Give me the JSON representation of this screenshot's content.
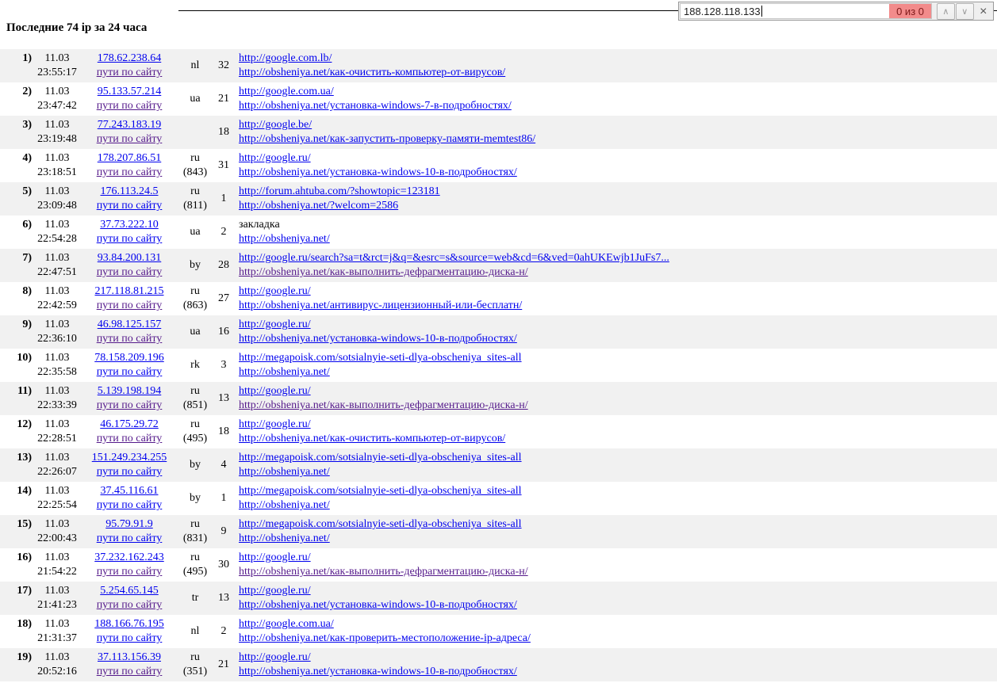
{
  "page": {
    "title": "Последние 74 ip за 24 часа"
  },
  "find_bar": {
    "query": "188.128.118.133",
    "match_count": "0 из 0",
    "prev_icon": "∧",
    "next_icon": "∨",
    "close_icon": "×"
  },
  "colors": {
    "link": "#0000EE",
    "visited": "#551A8B",
    "row_alt": "#f1f1f1",
    "badge_bg": "#f28b8b",
    "badge_text": "#7e1a1a"
  },
  "table": {
    "paths_label": "пути по сайту",
    "rows": [
      {
        "n": "1)",
        "date": "11.03",
        "time": "23:55:17",
        "ip": "178.62.238.64",
        "paths_visited": true,
        "geo": "nl",
        "geo_extra": "",
        "count": "32",
        "line1": "http://google.com.lb/",
        "line1_link": true,
        "line2": "http://obsheniya.net/как-очистить-компьютер-от-вирусов/",
        "line2_visited": false
      },
      {
        "n": "2)",
        "date": "11.03",
        "time": "23:47:42",
        "ip": "95.133.57.214",
        "paths_visited": true,
        "geo": "ua",
        "geo_extra": "",
        "count": "21",
        "line1": "http://google.com.ua/",
        "line1_link": true,
        "line2": "http://obsheniya.net/установка-windows-7-в-подробностях/",
        "line2_visited": false
      },
      {
        "n": "3)",
        "date": "11.03",
        "time": "23:19:48",
        "ip": "77.243.183.19",
        "paths_visited": true,
        "geo": "",
        "geo_extra": "",
        "count": "18",
        "line1": "http://google.be/",
        "line1_link": true,
        "line2": "http://obsheniya.net/как-запустить-проверку-памяти-memtest86/",
        "line2_visited": false
      },
      {
        "n": "4)",
        "date": "11.03",
        "time": "23:18:51",
        "ip": "178.207.86.51",
        "paths_visited": true,
        "geo": "ru",
        "geo_extra": "(843)",
        "count": "31",
        "line1": "http://google.ru/",
        "line1_link": true,
        "line2": "http://obsheniya.net/установка-windows-10-в-подробностях/",
        "line2_visited": false
      },
      {
        "n": "5)",
        "date": "11.03",
        "time": "23:09:48",
        "ip": "176.113.24.5",
        "paths_visited": false,
        "geo": "ru",
        "geo_extra": "(811)",
        "count": "1",
        "line1": "http://forum.ahtuba.com/?showtopic=123181",
        "line1_link": true,
        "line2": "http://obsheniya.net/?welcom=2586",
        "line2_visited": false
      },
      {
        "n": "6)",
        "date": "11.03",
        "time": "22:54:28",
        "ip": "37.73.222.10",
        "paths_visited": false,
        "geo": "ua",
        "geo_extra": "",
        "count": "2",
        "line1": "закладка",
        "line1_link": false,
        "line2": "http://obsheniya.net/",
        "line2_visited": false
      },
      {
        "n": "7)",
        "date": "11.03",
        "time": "22:47:51",
        "ip": "93.84.200.131",
        "paths_visited": true,
        "geo": "by",
        "geo_extra": "",
        "count": "28",
        "line1": "http://google.ru/search?sa=t&rct=j&q=&esrc=s&source=web&cd=6&ved=0ahUKEwjb1JuFs7...",
        "line1_link": true,
        "line2": "http://obsheniya.net/как-выполнить-дефрагментацию-диска-н/",
        "line2_visited": true
      },
      {
        "n": "8)",
        "date": "11.03",
        "time": "22:42:59",
        "ip": "217.118.81.215",
        "paths_visited": true,
        "geo": "ru",
        "geo_extra": "(863)",
        "count": "27",
        "line1": "http://google.ru/",
        "line1_link": true,
        "line2": "http://obsheniya.net/антивирус-лицензионный-или-бесплатн/",
        "line2_visited": false
      },
      {
        "n": "9)",
        "date": "11.03",
        "time": "22:36:10",
        "ip": "46.98.125.157",
        "paths_visited": true,
        "geo": "ua",
        "geo_extra": "",
        "count": "16",
        "line1": "http://google.ru/",
        "line1_link": true,
        "line2": "http://obsheniya.net/установка-windows-10-в-подробностях/",
        "line2_visited": false
      },
      {
        "n": "10)",
        "date": "11.03",
        "time": "22:35:58",
        "ip": "78.158.209.196",
        "paths_visited": false,
        "geo": "rk",
        "geo_extra": "",
        "count": "3",
        "line1": "http://megapoisk.com/sotsialnyie-seti-dlya-obscheniya_sites-all",
        "line1_link": true,
        "line2": "http://obsheniya.net/",
        "line2_visited": false
      },
      {
        "n": "11)",
        "date": "11.03",
        "time": "22:33:39",
        "ip": "5.139.198.194",
        "paths_visited": true,
        "geo": "ru",
        "geo_extra": "(851)",
        "count": "13",
        "line1": "http://google.ru/",
        "line1_link": true,
        "line2": "http://obsheniya.net/как-выполнить-дефрагментацию-диска-н/",
        "line2_visited": true
      },
      {
        "n": "12)",
        "date": "11.03",
        "time": "22:28:51",
        "ip": "46.175.29.72",
        "paths_visited": true,
        "geo": "ru",
        "geo_extra": "(495)",
        "count": "18",
        "line1": "http://google.ru/",
        "line1_link": true,
        "line2": "http://obsheniya.net/как-очистить-компьютер-от-вирусов/",
        "line2_visited": false
      },
      {
        "n": "13)",
        "date": "11.03",
        "time": "22:26:07",
        "ip": "151.249.234.255",
        "paths_visited": false,
        "geo": "by",
        "geo_extra": "",
        "count": "4",
        "line1": "http://megapoisk.com/sotsialnyie-seti-dlya-obscheniya_sites-all",
        "line1_link": true,
        "line2": "http://obsheniya.net/",
        "line2_visited": false
      },
      {
        "n": "14)",
        "date": "11.03",
        "time": "22:25:54",
        "ip": "37.45.116.61",
        "paths_visited": false,
        "geo": "by",
        "geo_extra": "",
        "count": "1",
        "line1": "http://megapoisk.com/sotsialnyie-seti-dlya-obscheniya_sites-all",
        "line1_link": true,
        "line2": "http://obsheniya.net/",
        "line2_visited": false
      },
      {
        "n": "15)",
        "date": "11.03",
        "time": "22:00:43",
        "ip": "95.79.91.9",
        "paths_visited": false,
        "geo": "ru",
        "geo_extra": "(831)",
        "count": "9",
        "line1": "http://megapoisk.com/sotsialnyie-seti-dlya-obscheniya_sites-all",
        "line1_link": true,
        "line2": "http://obsheniya.net/",
        "line2_visited": false
      },
      {
        "n": "16)",
        "date": "11.03",
        "time": "21:54:22",
        "ip": "37.232.162.243",
        "paths_visited": true,
        "geo": "ru",
        "geo_extra": "(495)",
        "count": "30",
        "line1": "http://google.ru/",
        "line1_link": true,
        "line2": "http://obsheniya.net/как-выполнить-дефрагментацию-диска-н/",
        "line2_visited": true
      },
      {
        "n": "17)",
        "date": "11.03",
        "time": "21:41:23",
        "ip": "5.254.65.145",
        "paths_visited": true,
        "geo": "tr",
        "geo_extra": "",
        "count": "13",
        "line1": "http://google.ru/",
        "line1_link": true,
        "line2": "http://obsheniya.net/установка-windows-10-в-подробностях/",
        "line2_visited": false
      },
      {
        "n": "18)",
        "date": "11.03",
        "time": "21:31:37",
        "ip": "188.166.76.195",
        "paths_visited": false,
        "geo": "nl",
        "geo_extra": "",
        "count": "2",
        "line1": "http://google.com.ua/",
        "line1_link": true,
        "line2": "http://obsheniya.net/как-проверить-местоположение-ip-адреса/",
        "line2_visited": false
      },
      {
        "n": "19)",
        "date": "11.03",
        "time": "20:52:16",
        "ip": "37.113.156.39",
        "paths_visited": true,
        "geo": "ru",
        "geo_extra": "(351)",
        "count": "21",
        "line1": "http://google.ru/",
        "line1_link": true,
        "line2": "http://obsheniya.net/установка-windows-10-в-подробностях/",
        "line2_visited": false
      }
    ]
  }
}
